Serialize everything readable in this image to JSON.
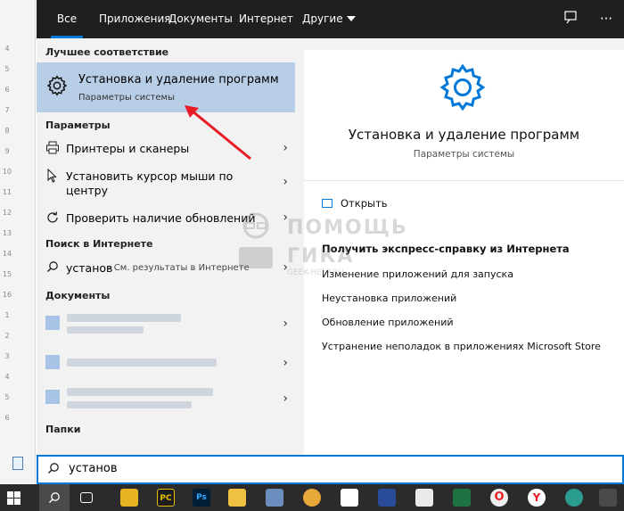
{
  "tabs": [
    {
      "label": "Все"
    },
    {
      "label": "Приложения"
    },
    {
      "label": "Документы"
    },
    {
      "label": "Интернет"
    },
    {
      "label": "Другие"
    }
  ],
  "ruler": [
    "4",
    "5",
    "6",
    "7",
    "8",
    "9",
    "10",
    "11",
    "12",
    "13",
    "14",
    "15",
    "16",
    "1",
    "2",
    "3",
    "4",
    "5",
    "6"
  ],
  "left": {
    "best_match_header": "Лучшее соответствие",
    "best_match": {
      "title": "Установка и удаление программ",
      "subtitle": "Параметры системы"
    },
    "settings_header": "Параметры",
    "settings": [
      {
        "label": "Принтеры и сканеры"
      },
      {
        "label": "Установить курсор мыши по"
      },
      {
        "label": "центру"
      },
      {
        "label": "Проверить наличие обновлений"
      }
    ],
    "web_header": "Поиск в Интернете",
    "web": {
      "query": "установ",
      "suffix": " - См. результаты в Интернете"
    },
    "docs_header": "Документы",
    "folders_header": "Папки"
  },
  "right": {
    "title": "Установка и удаление программ",
    "subtitle": "Параметры системы",
    "open_label": "Открыть",
    "help_header": "Получить экспресс-справку из Интернета",
    "links": [
      "Изменение приложений для запуска",
      "Неустановка приложений",
      "Обновление приложений",
      "Устранение неполадок в приложениях Microsoft Store"
    ]
  },
  "watermark": {
    "line1": "ПОМОЩЬ",
    "line2": "ГИКА",
    "line3": "GEEK-HELP.RU"
  },
  "search": {
    "value": "установ"
  },
  "taskbar": [
    "PC",
    "Ps",
    "O",
    "Y"
  ],
  "colors": {
    "accent": "#0078d7",
    "highlight": "#b8cde6",
    "topbar": "#1f1f1f",
    "arrow": "#e81c24"
  }
}
